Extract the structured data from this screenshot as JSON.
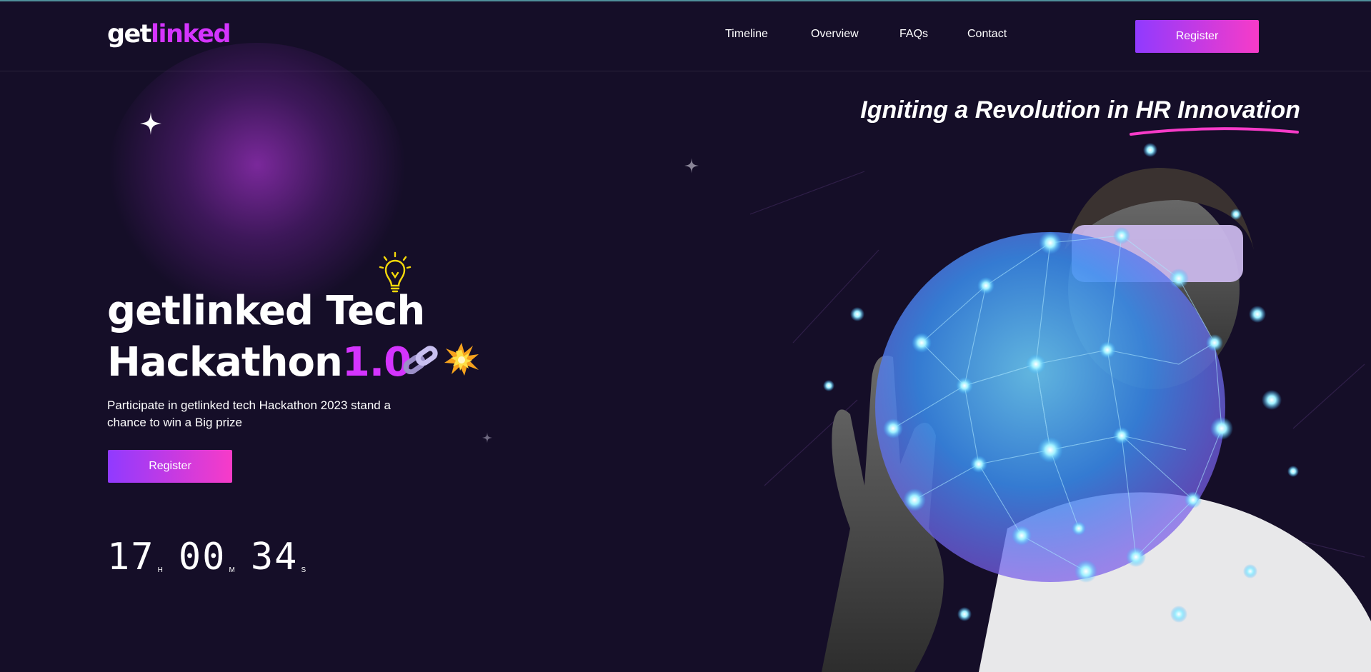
{
  "nav": {
    "logo_part1": "get",
    "logo_part2": "linked",
    "links": [
      "Timeline",
      "Overview",
      "FAQs",
      "Contact"
    ],
    "register_label": "Register"
  },
  "hero": {
    "tagline": "Igniting a Revolution in HR Innovation",
    "title_line1": "getlinked Tech",
    "title_line2": "Hackathon",
    "title_accent": "1.0",
    "description": "Participate in getlinked tech Hackathon 2023 stand a chance to win a Big prize",
    "register_label": "Register"
  },
  "countdown": {
    "hours": "17",
    "hours_unit": "H",
    "minutes": "00",
    "minutes_unit": "M",
    "seconds": "34",
    "seconds_unit": "S"
  },
  "colors": {
    "background": "#150e28",
    "accent": "#d434fe",
    "gradient_start": "#903aff",
    "gradient_end": "#f73bc8"
  },
  "icons": [
    "sparkle-icon",
    "lightbulb-icon",
    "chain-icon",
    "explosion-icon"
  ]
}
